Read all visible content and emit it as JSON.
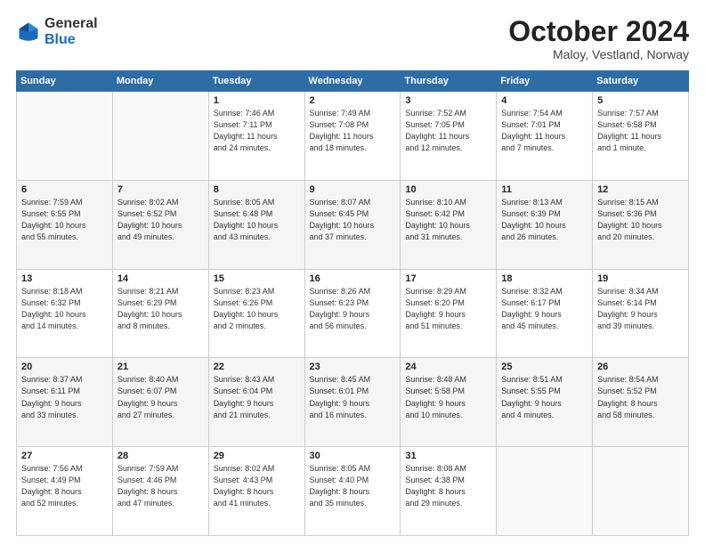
{
  "header": {
    "logo": {
      "general": "General",
      "blue": "Blue"
    },
    "title": "October 2024",
    "subtitle": "Maloy, Vestland, Norway"
  },
  "weekdays": [
    "Sunday",
    "Monday",
    "Tuesday",
    "Wednesday",
    "Thursday",
    "Friday",
    "Saturday"
  ],
  "weeks": [
    [
      {
        "day": "",
        "info": ""
      },
      {
        "day": "",
        "info": ""
      },
      {
        "day": "1",
        "info": "Sunrise: 7:46 AM\nSunset: 7:11 PM\nDaylight: 11 hours\nand 24 minutes."
      },
      {
        "day": "2",
        "info": "Sunrise: 7:49 AM\nSunset: 7:08 PM\nDaylight: 11 hours\nand 18 minutes."
      },
      {
        "day": "3",
        "info": "Sunrise: 7:52 AM\nSunset: 7:05 PM\nDaylight: 11 hours\nand 12 minutes."
      },
      {
        "day": "4",
        "info": "Sunrise: 7:54 AM\nSunset: 7:01 PM\nDaylight: 11 hours\nand 7 minutes."
      },
      {
        "day": "5",
        "info": "Sunrise: 7:57 AM\nSunset: 6:58 PM\nDaylight: 11 hours\nand 1 minute."
      }
    ],
    [
      {
        "day": "6",
        "info": "Sunrise: 7:59 AM\nSunset: 6:55 PM\nDaylight: 10 hours\nand 55 minutes."
      },
      {
        "day": "7",
        "info": "Sunrise: 8:02 AM\nSunset: 6:52 PM\nDaylight: 10 hours\nand 49 minutes."
      },
      {
        "day": "8",
        "info": "Sunrise: 8:05 AM\nSunset: 6:48 PM\nDaylight: 10 hours\nand 43 minutes."
      },
      {
        "day": "9",
        "info": "Sunrise: 8:07 AM\nSunset: 6:45 PM\nDaylight: 10 hours\nand 37 minutes."
      },
      {
        "day": "10",
        "info": "Sunrise: 8:10 AM\nSunset: 6:42 PM\nDaylight: 10 hours\nand 31 minutes."
      },
      {
        "day": "11",
        "info": "Sunrise: 8:13 AM\nSunset: 6:39 PM\nDaylight: 10 hours\nand 26 minutes."
      },
      {
        "day": "12",
        "info": "Sunrise: 8:15 AM\nSunset: 6:36 PM\nDaylight: 10 hours\nand 20 minutes."
      }
    ],
    [
      {
        "day": "13",
        "info": "Sunrise: 8:18 AM\nSunset: 6:32 PM\nDaylight: 10 hours\nand 14 minutes."
      },
      {
        "day": "14",
        "info": "Sunrise: 8:21 AM\nSunset: 6:29 PM\nDaylight: 10 hours\nand 8 minutes."
      },
      {
        "day": "15",
        "info": "Sunrise: 8:23 AM\nSunset: 6:26 PM\nDaylight: 10 hours\nand 2 minutes."
      },
      {
        "day": "16",
        "info": "Sunrise: 8:26 AM\nSunset: 6:23 PM\nDaylight: 9 hours\nand 56 minutes."
      },
      {
        "day": "17",
        "info": "Sunrise: 8:29 AM\nSunset: 6:20 PM\nDaylight: 9 hours\nand 51 minutes."
      },
      {
        "day": "18",
        "info": "Sunrise: 8:32 AM\nSunset: 6:17 PM\nDaylight: 9 hours\nand 45 minutes."
      },
      {
        "day": "19",
        "info": "Sunrise: 8:34 AM\nSunset: 6:14 PM\nDaylight: 9 hours\nand 39 minutes."
      }
    ],
    [
      {
        "day": "20",
        "info": "Sunrise: 8:37 AM\nSunset: 6:11 PM\nDaylight: 9 hours\nand 33 minutes."
      },
      {
        "day": "21",
        "info": "Sunrise: 8:40 AM\nSunset: 6:07 PM\nDaylight: 9 hours\nand 27 minutes."
      },
      {
        "day": "22",
        "info": "Sunrise: 8:43 AM\nSunset: 6:04 PM\nDaylight: 9 hours\nand 21 minutes."
      },
      {
        "day": "23",
        "info": "Sunrise: 8:45 AM\nSunset: 6:01 PM\nDaylight: 9 hours\nand 16 minutes."
      },
      {
        "day": "24",
        "info": "Sunrise: 8:48 AM\nSunset: 5:58 PM\nDaylight: 9 hours\nand 10 minutes."
      },
      {
        "day": "25",
        "info": "Sunrise: 8:51 AM\nSunset: 5:55 PM\nDaylight: 9 hours\nand 4 minutes."
      },
      {
        "day": "26",
        "info": "Sunrise: 8:54 AM\nSunset: 5:52 PM\nDaylight: 8 hours\nand 58 minutes."
      }
    ],
    [
      {
        "day": "27",
        "info": "Sunrise: 7:56 AM\nSunset: 4:49 PM\nDaylight: 8 hours\nand 52 minutes."
      },
      {
        "day": "28",
        "info": "Sunrise: 7:59 AM\nSunset: 4:46 PM\nDaylight: 8 hours\nand 47 minutes."
      },
      {
        "day": "29",
        "info": "Sunrise: 8:02 AM\nSunset: 4:43 PM\nDaylight: 8 hours\nand 41 minutes."
      },
      {
        "day": "30",
        "info": "Sunrise: 8:05 AM\nSunset: 4:40 PM\nDaylight: 8 hours\nand 35 minutes."
      },
      {
        "day": "31",
        "info": "Sunrise: 8:08 AM\nSunset: 4:38 PM\nDaylight: 8 hours\nand 29 minutes."
      },
      {
        "day": "",
        "info": ""
      },
      {
        "day": "",
        "info": ""
      }
    ]
  ]
}
